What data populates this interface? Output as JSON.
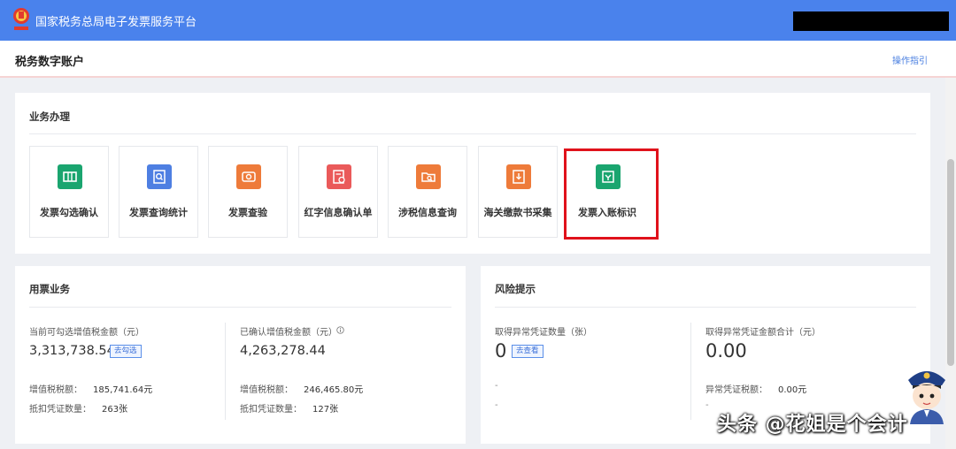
{
  "header": {
    "app_title": "国家税务总局电子发票服务平台",
    "brand_color": "#4a82ec"
  },
  "subheader": {
    "page_title": "税务数字账户",
    "guide_link": "操作指引"
  },
  "business": {
    "title": "业务办理",
    "tiles": [
      {
        "label": "发票勾选确认",
        "icon": "ticket-icon",
        "color": "#1aa56f"
      },
      {
        "label": "发票查询统计",
        "icon": "document-search-icon",
        "color": "#4e7fe2"
      },
      {
        "label": "发票查验",
        "icon": "ticket-check-icon",
        "color": "#ee7b3a"
      },
      {
        "label": "红字信息确认单",
        "icon": "document-stamp-icon",
        "color": "#ea5a5a"
      },
      {
        "label": "涉税信息查询",
        "icon": "folder-search-icon",
        "color": "#ee7b3a"
      },
      {
        "label": "海关缴款书采集",
        "icon": "customs-document-icon",
        "color": "#ee7b3a"
      },
      {
        "label": "发票入账标识",
        "icon": "ledger-mark-icon",
        "color": "#1aa56f"
      }
    ],
    "highlight_color": "#e0121b"
  },
  "usage": {
    "title": "用票业务",
    "left": {
      "label": "当前可勾选增值税金额（元）",
      "value": "3,313,738.54",
      "button": "去勾选",
      "tax_label": "增值税税额：",
      "tax_value": "185,741.64元",
      "count_label": "抵扣凭证数量：",
      "count_value": "263张"
    },
    "right": {
      "label": "已确认增值税金额（元）",
      "value": "4,263,278.44",
      "tax_label": "增值税税额：",
      "tax_value": "246,465.80元",
      "count_label": "抵扣凭证数量：",
      "count_value": "127张"
    }
  },
  "risk": {
    "title": "风险提示",
    "left": {
      "label": "取得异常凭证数量（张）",
      "value": "0",
      "button": "去查看",
      "dash1": "-",
      "dash2": "-"
    },
    "right": {
      "label": "取得异常凭证金额合计（元）",
      "value": "0.00",
      "tax_label": "异常凭证税额：",
      "tax_value": "0.00元",
      "dash": "-"
    }
  },
  "watermark": "头条 @花姐是个会计"
}
